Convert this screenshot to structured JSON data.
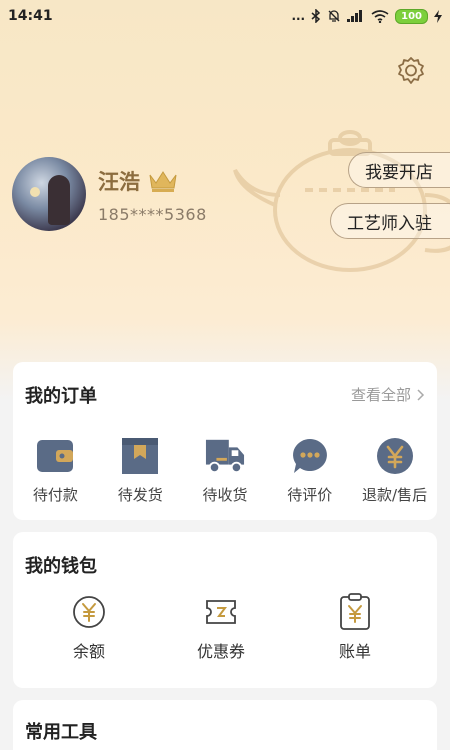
{
  "status_bar": {
    "time": "14:41",
    "dots": "...",
    "battery": "100"
  },
  "profile": {
    "name": "汪浩",
    "phone": "185****5368"
  },
  "actions": {
    "open_store": "我要开店",
    "craftsman_join": "工艺师入驻"
  },
  "orders": {
    "title": "我的订单",
    "view_all": "查看全部",
    "items": [
      {
        "label": "待付款",
        "icon": "wallet-icon"
      },
      {
        "label": "待发货",
        "icon": "package-icon"
      },
      {
        "label": "待收货",
        "icon": "truck-icon"
      },
      {
        "label": "待评价",
        "icon": "comment-icon"
      },
      {
        "label": "退款/售后",
        "icon": "refund-icon"
      }
    ]
  },
  "wallet": {
    "title": "我的钱包",
    "items": [
      {
        "label": "余额",
        "icon": "yuan-coin-icon"
      },
      {
        "label": "优惠券",
        "icon": "coupon-icon"
      },
      {
        "label": "账单",
        "icon": "bill-icon"
      }
    ]
  },
  "tools": {
    "title": "常用工具"
  },
  "colors": {
    "accent_gold": "#8c6d3f",
    "icon_slate": "#5a6b86",
    "icon_gold": "#d2a75a"
  }
}
